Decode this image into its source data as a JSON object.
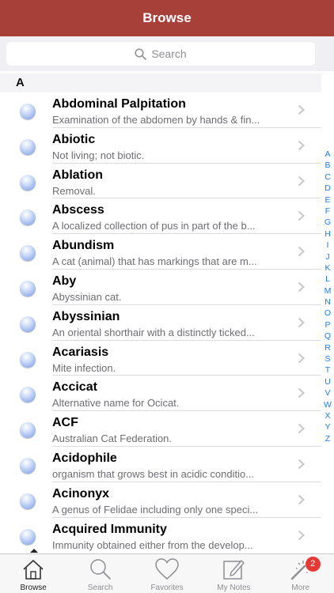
{
  "navbar": {
    "title": "Browse"
  },
  "search": {
    "placeholder": "Search"
  },
  "section": {
    "letter": "A"
  },
  "entries": [
    {
      "term": "Abdominal Palpitation",
      "definition": "Examination of the abdomen by hands & fin..."
    },
    {
      "term": "Abiotic",
      "definition": "Not living; not biotic."
    },
    {
      "term": "Ablation",
      "definition": "Removal."
    },
    {
      "term": "Abscess",
      "definition": "A localized collection of pus in part of the b..."
    },
    {
      "term": "Abundism",
      "definition": "A cat (animal) that has markings that are m..."
    },
    {
      "term": "Aby",
      "definition": "Abyssinian cat."
    },
    {
      "term": "Abyssinian",
      "definition": "An oriental shorthair with a distinctly ticked..."
    },
    {
      "term": "Acariasis",
      "definition": "Mite infection."
    },
    {
      "term": "Accicat",
      "definition": "Alternative name for Ocicat."
    },
    {
      "term": "ACF",
      "definition": "Australian Cat Federation."
    },
    {
      "term": "Acidophile",
      "definition": "organism that grows best in acidic conditio..."
    },
    {
      "term": "Acinonyx",
      "definition": "A genus of Felidae including only one speci..."
    },
    {
      "term": "Acquired Immunity",
      "definition": "Immunity obtained either from the develop..."
    }
  ],
  "index": [
    "A",
    "B",
    "C",
    "D",
    "E",
    "F",
    "G",
    "H",
    "I",
    "J",
    "K",
    "L",
    "M",
    "N",
    "O",
    "P",
    "Q",
    "R",
    "S",
    "T",
    "U",
    "V",
    "W",
    "X",
    "Y",
    "Z"
  ],
  "tabs": [
    {
      "label": "Browse",
      "icon": "house-icon"
    },
    {
      "label": "Search",
      "icon": "magnifier-icon"
    },
    {
      "label": "Favorites",
      "icon": "heart-icon"
    },
    {
      "label": "My Notes",
      "icon": "pencil-note-icon"
    },
    {
      "label": "More",
      "icon": "magic-wand-icon",
      "badge": "2"
    }
  ],
  "colors": {
    "navbar": "#a8403a",
    "index_letters": "#1a7cf6",
    "badge": "#e53935"
  }
}
